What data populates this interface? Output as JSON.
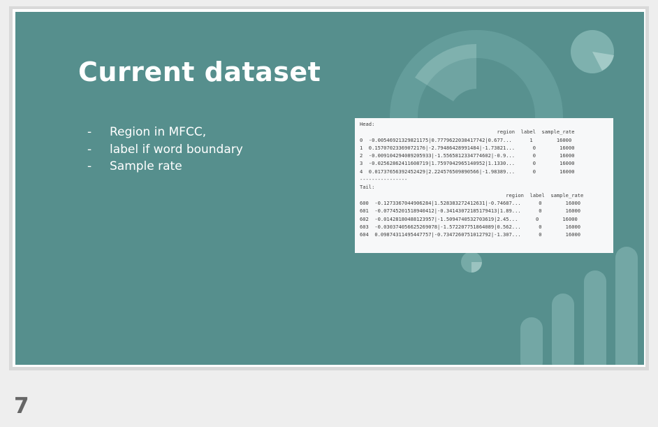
{
  "slide": {
    "title": "Current dataset",
    "bullets": [
      {
        "marker": "-",
        "text": "Region in MFCC,"
      },
      {
        "marker": "-",
        "text": "label if word boundary"
      },
      {
        "marker": "-",
        "text": "Sample rate"
      }
    ]
  },
  "table_image": {
    "head_label": "Head:",
    "head_columns": "                                              region  label  sample_rate",
    "head_rows": [
      "0  -0.00546921329821175|0.7779622038417742|0.677...      1        16000",
      "1  0.1570702336907217б|-2.79486428991484|-1.73821...      0        16000",
      "2  -0.009104294089205933|-1.5565812334774602|-0.9...      0        16000",
      "3  -0.02562862411608719|1.7597042965140952|1.1330...      0        16000",
      "4  0.01737656392452429|2.224576509890566|-1.98389...      0        16000"
    ],
    "separator": "----------------",
    "tail_label": "Tail:",
    "tail_columns": "                                                 region  label  sample_rate",
    "tail_rows": [
      "600  -0.1273367044906284|1.528383272412631|-0.74687...      0        16000",
      "601  -0.07745201518940412|-0.3414307218517941З|1.89...      0        16000",
      "602  -0.01428180488123957|-1.5094740532703619|2.45...      0        16000",
      "603  -0.030374056625269078|-1.572207751864089|0.562...      0        16000",
      "604  0.09874311495447757|-0.7347260751012792|-1.307...      0        16000"
    ]
  },
  "page_number": "7",
  "colors": {
    "slide_bg": "#568f8d",
    "text": "#ffffff",
    "deco": "#6fa6a4"
  }
}
